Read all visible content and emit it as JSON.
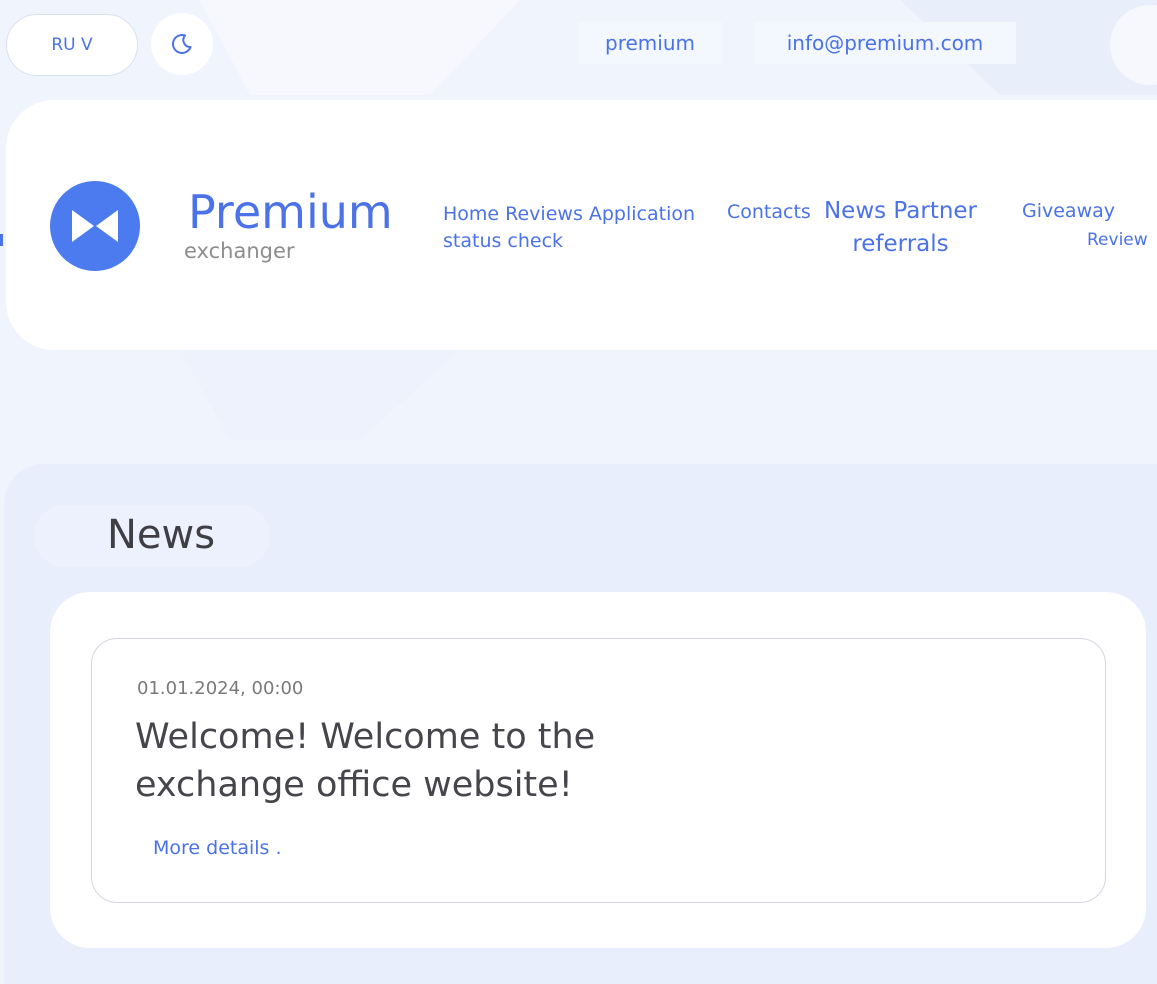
{
  "topbar": {
    "language_label": "RU V",
    "theme_icon": "moon-icon",
    "site_link": "premium",
    "email_link": "info@premium.com"
  },
  "brand": {
    "logo_icon": "bowtie-logo-icon",
    "title": "Premium",
    "subtitle": "exchanger"
  },
  "nav": {
    "home_reviews_application": "Home Reviews Application",
    "status_check": "status check",
    "contacts": "Contacts",
    "news_partner": "News Partner",
    "referrals": "referrals",
    "giveaway": "Giveaway",
    "review": "Review"
  },
  "news": {
    "section_title": "News",
    "items": [
      {
        "date": "01.01.2024, 00:00",
        "headline": "Welcome! Welcome to the exchange office website!",
        "more_label": "More details ."
      }
    ]
  },
  "colors": {
    "accent": "#4b72e6",
    "logo": "#4b7bef",
    "background": "#f0f4fd",
    "section": "#e9eefd"
  }
}
